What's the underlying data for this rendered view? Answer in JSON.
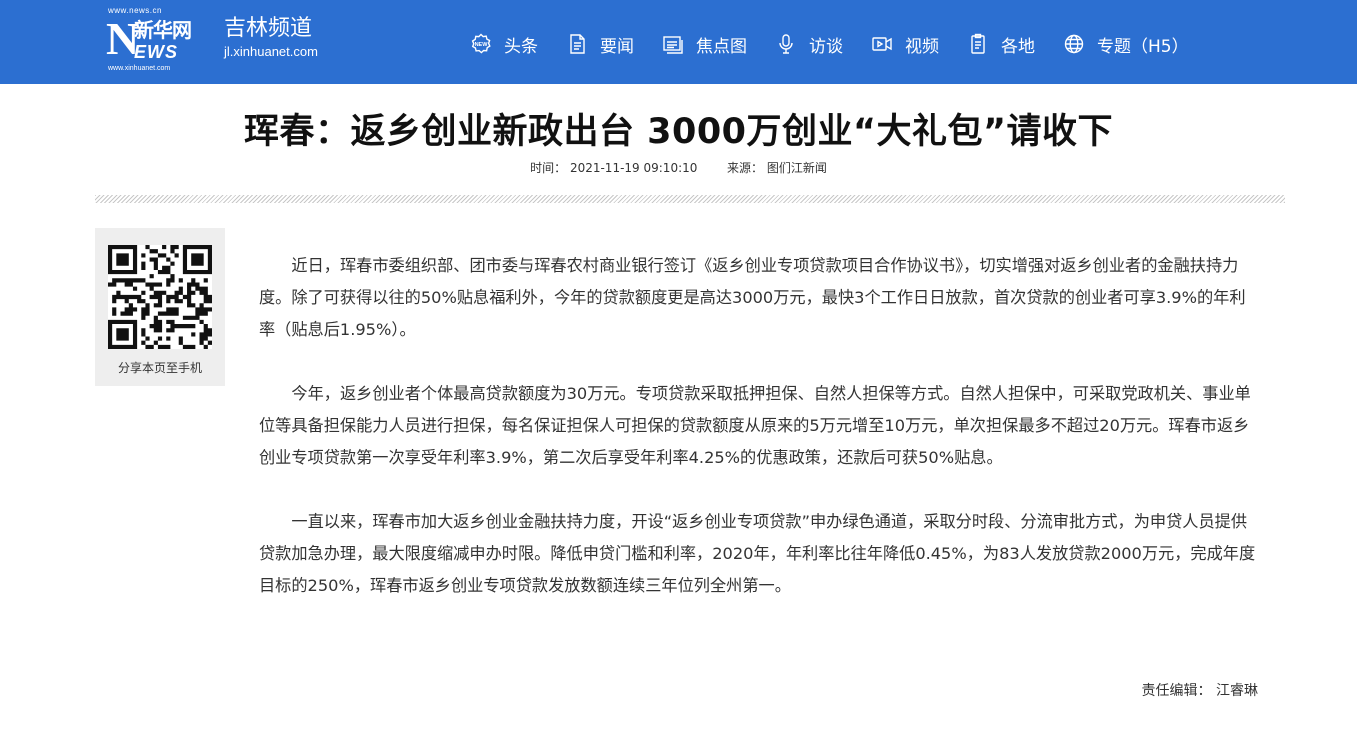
{
  "header": {
    "logo": {
      "url_top": "www.news.cn",
      "big_letter": "N",
      "name_cn": "新华网",
      "name_en": "EWS",
      "url_bottom": "www.xinhuanet.com"
    },
    "channel_name": "吉林频道",
    "channel_url": "jl.xinhuanet.com",
    "nav": [
      {
        "label": "头条",
        "icon": "news-badge-icon"
      },
      {
        "label": "要闻",
        "icon": "document-icon"
      },
      {
        "label": "焦点图",
        "icon": "gallery-icon"
      },
      {
        "label": "访谈",
        "icon": "microphone-icon"
      },
      {
        "label": "视频",
        "icon": "video-camera-icon"
      },
      {
        "label": "各地",
        "icon": "clipboard-icon"
      },
      {
        "label": "专题（H5）",
        "icon": "globe-icon"
      }
    ]
  },
  "article": {
    "title": "珲春：返乡创业新政出台 3000万创业“大礼包”请收下",
    "time_label": "时间：",
    "time_value": "2021-11-19 09:10:10",
    "source_label": "来源：",
    "source_value": "图们江新闻",
    "paragraphs": [
      "近日，珲春市委组织部、团市委与珲春农村商业银行签订《返乡创业专项贷款项目合作协议书》，切实增强对返乡创业者的金融扶持力度。除了可获得以往的50%贴息福利外，今年的贷款额度更是高达3000万元，最快3个工作日日放款，首次贷款的创业者可享3.9%的年利率（贴息后1.95%）。",
      "今年，返乡创业者个体最高贷款额度为30万元。专项贷款采取抵押担保、自然人担保等方式。自然人担保中，可采取党政机关、事业单位等具备担保能力人员进行担保，每名保证担保人可担保的贷款额度从原来的5万元增至10万元，单次担保最多不超过20万元。珲春市返乡创业专项贷款第一次享受年利率3.9%，第二次后享受年利率4.25%的优惠政策，还款后可获50%贴息。",
      "一直以来，珲春市加大返乡创业金融扶持力度，开设“返乡创业专项贷款”申办绿色通道，采取分时段、分流审批方式，为申贷人员提供贷款加急办理，最大限度缩减申办时限。降低申贷门槛和利率，2020年，年利率比往年降低0.45%，为83人发放贷款2000万元，完成年度目标的250%，珲春市返乡创业专项贷款发放数额连续三年位列全州第一。"
    ],
    "editor_label": "责任编辑：",
    "editor_name": "江睿琳"
  },
  "share": {
    "label": "分享本页至手机"
  },
  "colors": {
    "header_bg": "#2c6fd1",
    "share_bg": "#eeeeee"
  }
}
